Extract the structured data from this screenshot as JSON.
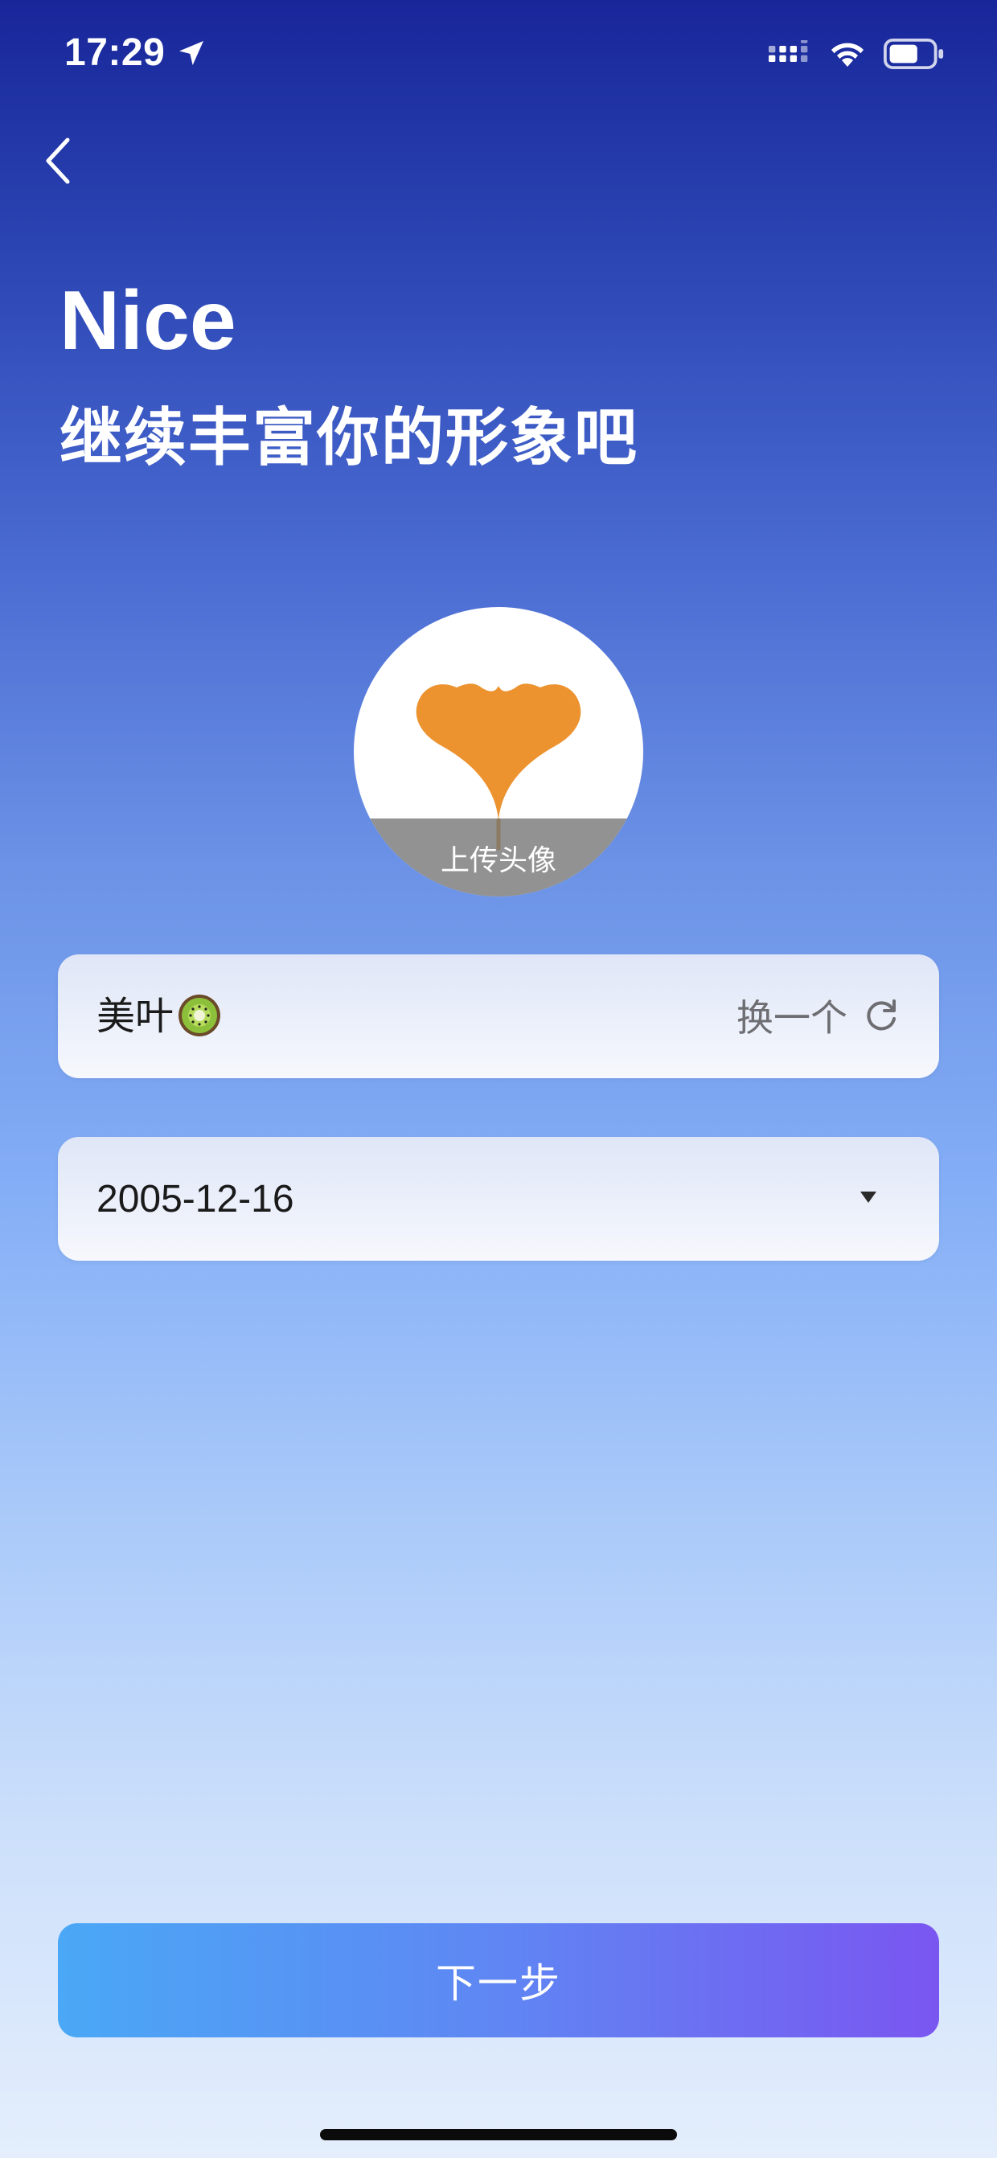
{
  "status_bar": {
    "time": "17:29",
    "icons": [
      "location-arrow-icon",
      "signal-icon",
      "wifi-icon",
      "battery-icon"
    ]
  },
  "header": {
    "back_icon": "chevron-left-icon",
    "title": "Nice",
    "subtitle": "继续丰富你的形象吧"
  },
  "avatar": {
    "image": "ginkgo-leaf-avatar",
    "upload_label": "上传头像"
  },
  "name_field": {
    "value": "美叶",
    "emoji": "kiwi-emoji",
    "change_label": "换一个",
    "change_icon": "refresh-icon"
  },
  "birthday_field": {
    "value": "2005-12-16",
    "dropdown_icon": "caret-down-icon"
  },
  "next_button": {
    "label": "下一步"
  },
  "colors": {
    "gradient_top": "#18269a",
    "gradient_bottom": "#e4eefc",
    "button_start": "#4aa8f6",
    "button_end": "#7a56f1",
    "leaf": "#ec9330"
  }
}
